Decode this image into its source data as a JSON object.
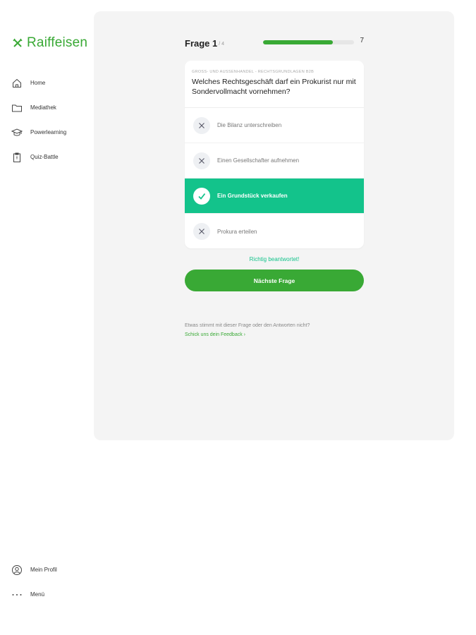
{
  "brand": {
    "name": "Raiffeisen",
    "color": "#39a935"
  },
  "sidebar": {
    "items": [
      {
        "label": "Home",
        "icon": "home-icon"
      },
      {
        "label": "Mediathek",
        "icon": "folder-icon"
      },
      {
        "label": "Powerlearning",
        "icon": "graduation-cap-icon"
      },
      {
        "label": "Quiz-Battle",
        "icon": "clipboard-icon"
      }
    ],
    "bottom": [
      {
        "label": "Mein Profil",
        "icon": "user-icon"
      },
      {
        "label": "Menü",
        "icon": "more-dots-icon"
      }
    ]
  },
  "quiz": {
    "title": "Frage 1",
    "total": "/ 4",
    "progress": 0.77,
    "score": "7",
    "category": "Gross- und Aussenhandel - Rechtsgrundlagen B2B",
    "question": "Welches Rechtsgeschäft darf ein Prokurist nur mit Sondervollmacht vornehmen?",
    "answers": [
      {
        "text": "Die Bilanz unterschreiben",
        "state": "wrong"
      },
      {
        "text": "Einen Gesellschafter aufnehmen",
        "state": "wrong"
      },
      {
        "text": "Ein Grundstück verkaufen",
        "state": "correct"
      },
      {
        "text": "Prokura erteilen",
        "state": "wrong"
      }
    ],
    "result_text": "Richtig beantwortet!",
    "next_label": "Nächste Frage",
    "feedback_question": "Etwas stimmt mit dieser Frage oder den Antworten nicht?",
    "feedback_link": "Schick uns dein Feedback ›"
  },
  "colors": {
    "accent": "#39a935",
    "correct": "#13c38b",
    "panel": "#f4f4f4"
  }
}
